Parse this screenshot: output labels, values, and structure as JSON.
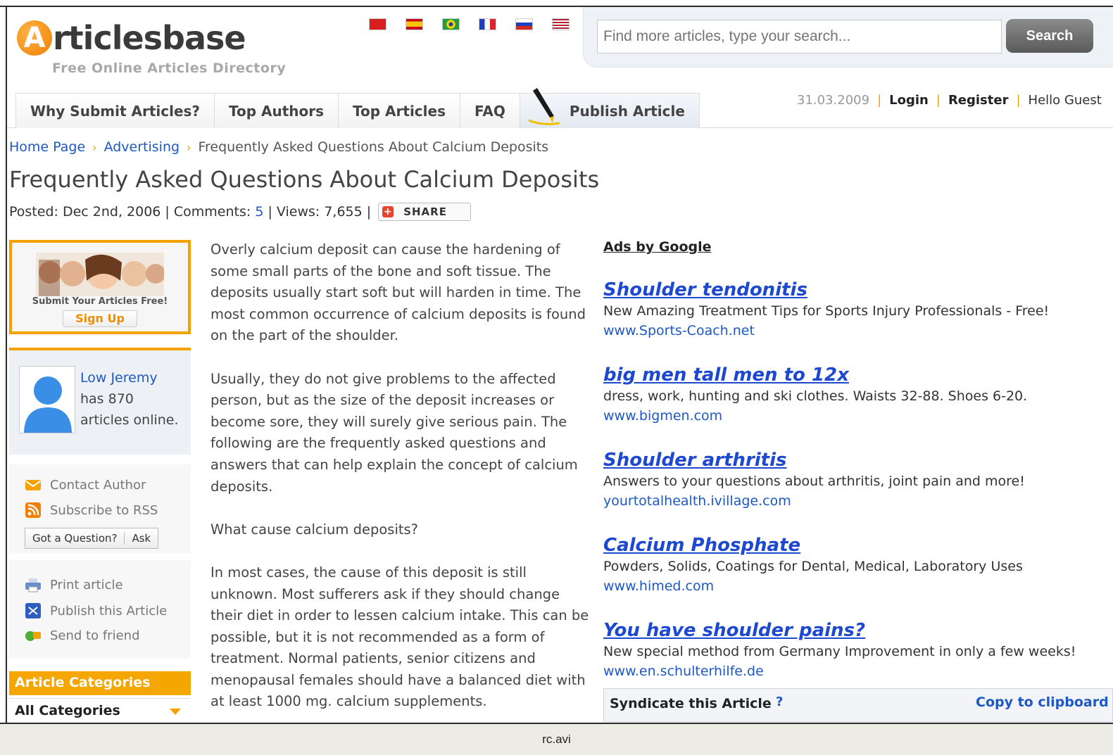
{
  "header": {
    "logo_letter": "A",
    "logo_text": "rticlesbase",
    "tagline": "Free Online Articles Directory"
  },
  "languages": [
    {
      "name": "china-flag-icon",
      "color": "#d81e1e"
    },
    {
      "name": "spain-flag-icon",
      "color": "#f4c400"
    },
    {
      "name": "brazil-flag-icon",
      "color": "#1e9e3e"
    },
    {
      "name": "france-flag-icon",
      "color": "#1f3fbf"
    },
    {
      "name": "russia-flag-icon",
      "color": "#ffffff"
    },
    {
      "name": "usa-flag-icon",
      "color": "#b22234"
    }
  ],
  "search": {
    "placeholder": "Find more articles, type your search...",
    "button": "Search"
  },
  "nav": {
    "items": [
      "Why Submit Articles?",
      "Top Authors",
      "Top Articles",
      "FAQ"
    ],
    "publish": "Publish Article"
  },
  "userbar": {
    "date": "31.03.2009",
    "login": "Login",
    "register": "Register",
    "greeting": "Hello Guest"
  },
  "breadcrumb": {
    "home": "Home Page",
    "category": "Advertising",
    "current": "Frequently Asked Questions About Calcium Deposits"
  },
  "article": {
    "title": "Frequently Asked Questions About Calcium Deposits",
    "posted_label": "Posted:",
    "posted_date": "Dec 2nd, 2006",
    "comments_label": "Comments:",
    "comments_count": "5",
    "views_label": "Views:",
    "views_count": "7,655",
    "share": "SHARE",
    "paragraphs": [
      "Overly calcium deposit can cause the hardening of some small parts of the bone and soft tissue. The deposits usually start soft but will harden in time. The most common occurrence of calcium deposits is found on the part of the shoulder.",
      "Usually, they do not give problems to the affected person, but as the size of the deposit increases or become sore, they will surely give serious pain. The following are the frequently asked questions and answers that can help explain the concept of calcium deposits.",
      "What cause calcium deposits?",
      "In most cases, the cause of this deposit is still unknown. Most sufferers ask if they should change their diet in order to lessen calcium intake. This can be possible, but it is not recommended as a form of treatment. Normal patients, senior citizens and menopausal females should have a balanced diet with at least 1000 mg. calcium supplements."
    ]
  },
  "sidebar": {
    "promo_text": "Submit Your Articles Free!",
    "promo_button": "Sign Up",
    "author_name": "Low Jeremy",
    "author_has": "has 870",
    "author_online": "articles online.",
    "contact": "Contact Author",
    "rss": "Subscribe to RSS",
    "question": "Got a Question?",
    "ask": "Ask",
    "print": "Print article",
    "publish": "Publish this Article",
    "send": "Send to friend",
    "categories_header": "Article Categories",
    "categories_selected": "All Categories"
  },
  "ads": {
    "heading": "Ads by Google",
    "items": [
      {
        "title": "Shoulder tendonitis",
        "desc": "New Amazing Treatment Tips for Sports Injury Professionals - Free!",
        "url": "www.Sports-Coach.net"
      },
      {
        "title": "big men tall men to 12x",
        "desc": "dress, work, hunting and ski clothes. Waists 32-88. Shoes 6-20.",
        "url": "www.bigmen.com"
      },
      {
        "title": "Shoulder arthritis",
        "desc": "Answers to your questions about arthritis, joint pain and more!",
        "url": "yourtotalhealth.ivillage.com"
      },
      {
        "title": "Calcium Phosphate",
        "desc": "Powders, Solids, Coatings for Dental, Medical, Laboratory Uses",
        "url": "www.himed.com"
      },
      {
        "title": "You have shoulder pains?",
        "desc": "New special method from Germany Improvement in only a few weeks!",
        "url": "www.en.schulterhilfe.de"
      }
    ]
  },
  "syndicate": {
    "title": "Syndicate this Article",
    "help": "?",
    "copy": "Copy to clipboard"
  },
  "statusbar": {
    "text": "rc.avi"
  },
  "colors": {
    "accent": "#f5a100",
    "link": "#1d58c4",
    "ad_title": "#1d48d0"
  }
}
